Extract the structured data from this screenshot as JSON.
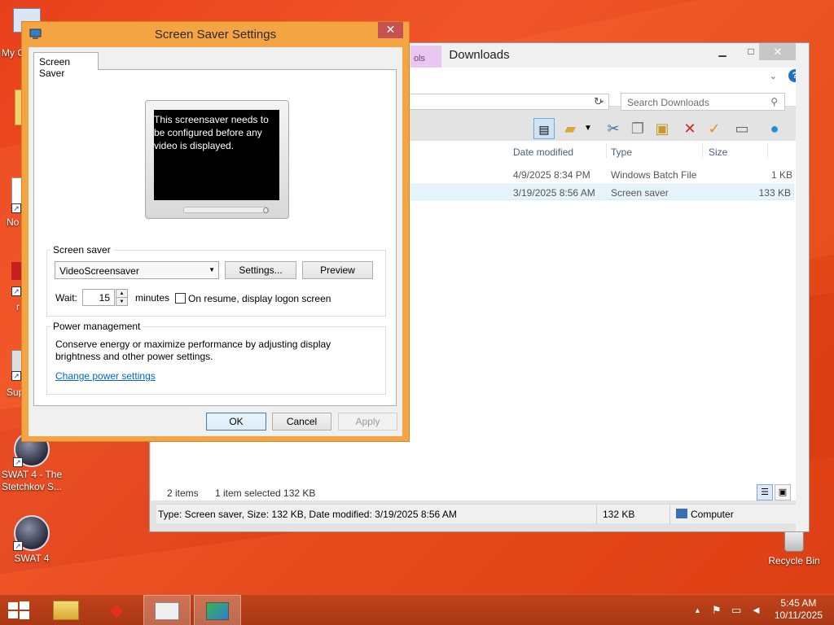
{
  "desktop": {
    "icons": [
      {
        "label": "My C",
        "name": "my-computer"
      },
      {
        "label": "No",
        "name": "notepad"
      },
      {
        "label": "r",
        "name": "app-r"
      },
      {
        "label": "Sup",
        "name": "support"
      },
      {
        "label": "SWAT 4 - The Stetchkov S...",
        "name": "swat4-stetchkov"
      },
      {
        "label": "SWAT 4",
        "name": "swat4"
      },
      {
        "label": "Recycle Bin",
        "name": "recycle-bin"
      }
    ]
  },
  "explorer": {
    "title": "Downloads",
    "tools_tab": "ols",
    "search_placeholder": "Search Downloads",
    "columns": [
      "Date modified",
      "Type",
      "Size"
    ],
    "files": [
      {
        "date": "4/9/2025 8:34 PM",
        "type": "Windows Batch File",
        "size": "1 KB",
        "selected": false
      },
      {
        "date": "3/19/2025 8:56 AM",
        "type": "Screen saver",
        "size": "133 KB",
        "selected": true
      }
    ],
    "status_items": "2 items",
    "status_selected": "1 item selected  132 KB",
    "details_bar": "Type: Screen saver, Size: 132 KB, Date modified: 3/19/2025 8:56 AM",
    "details_size": "132 KB",
    "details_location": "Computer"
  },
  "dialog": {
    "title": "Screen Saver Settings",
    "tab": "Screen Saver",
    "preview_text": "This screensaver needs to be configured before any video is displayed.",
    "screensaver_group": "Screen saver",
    "selected_screensaver": "VideoScreensaver",
    "settings_button": "Settings...",
    "preview_button": "Preview",
    "wait_label": "Wait:",
    "wait_value": "15",
    "minutes_label": "minutes",
    "resume_label": "On resume, display logon screen",
    "power_group": "Power management",
    "power_text": "Conserve energy or maximize performance by adjusting display brightness and other power settings.",
    "power_link": "Change power settings",
    "ok": "OK",
    "cancel": "Cancel",
    "apply": "Apply"
  },
  "taskbar": {
    "time": "5:45 AM",
    "date": "10/11/2025"
  }
}
